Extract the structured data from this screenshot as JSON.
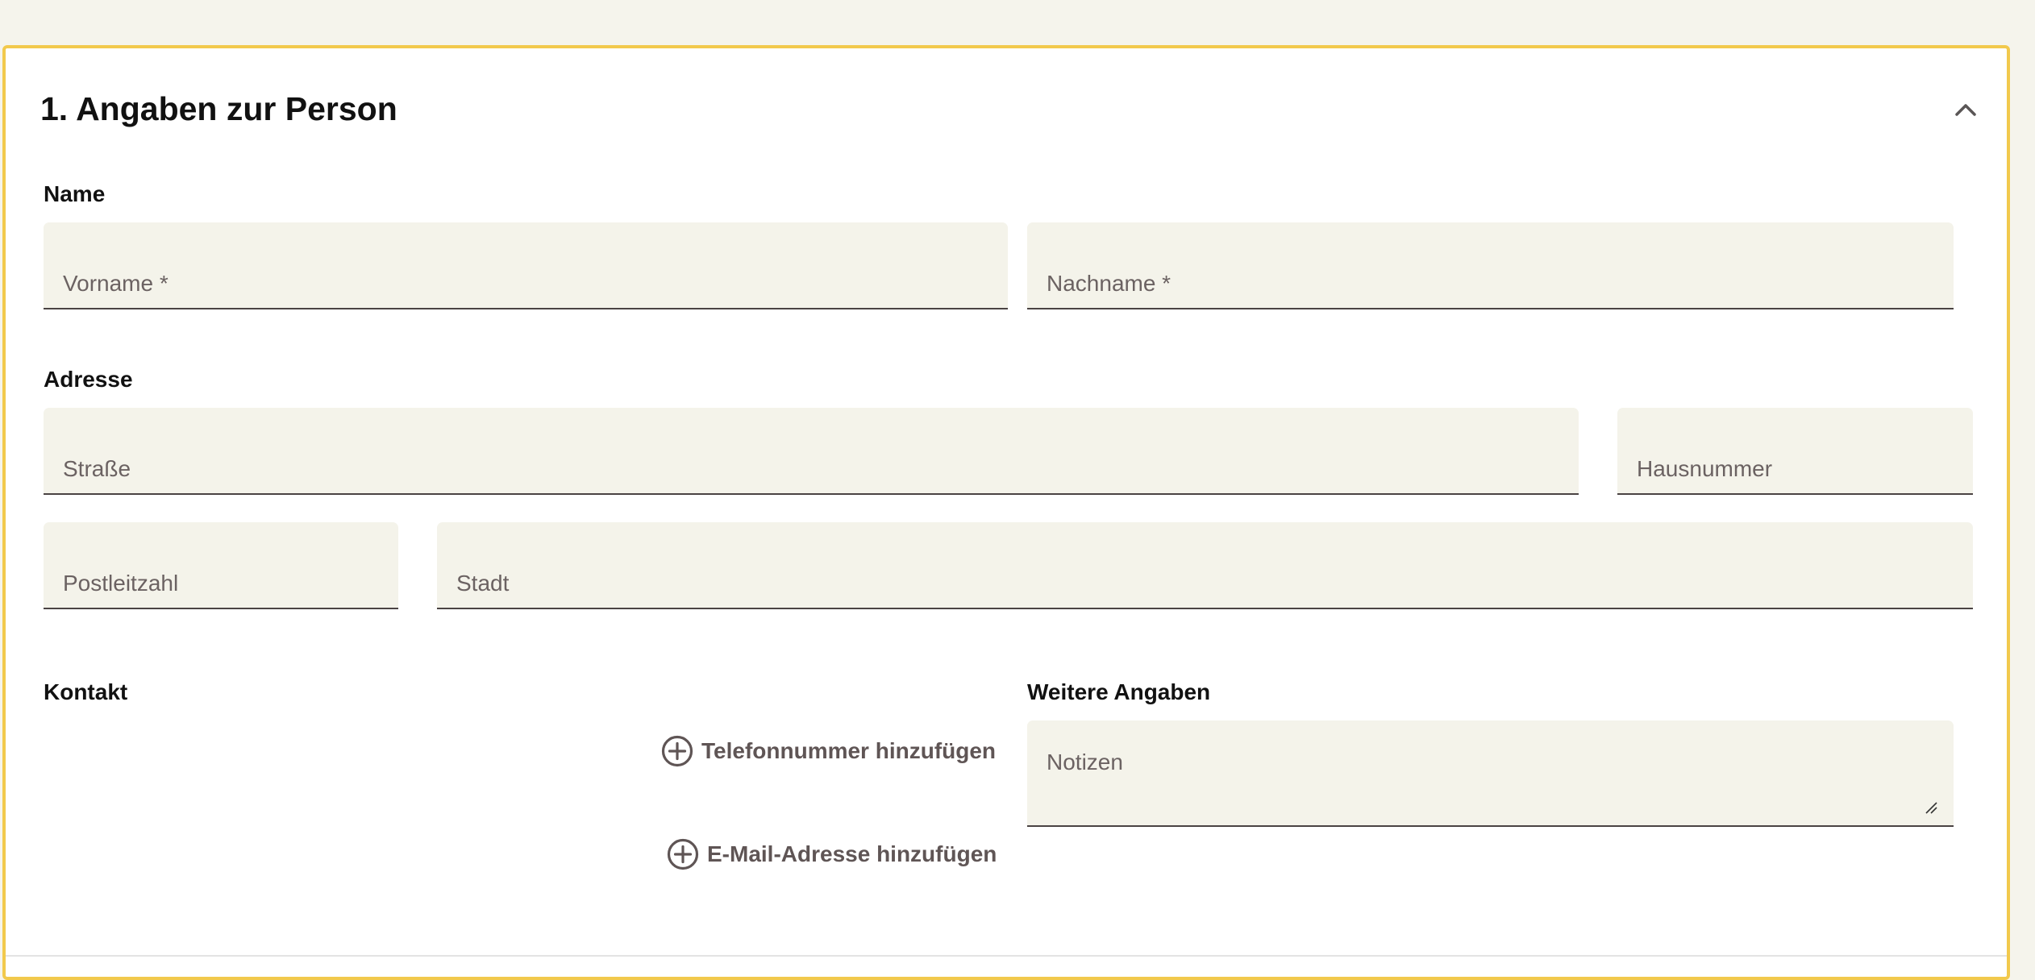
{
  "section": {
    "title": "1. Angaben zur Person",
    "collapse_icon": "chevron-up-icon"
  },
  "name_group": {
    "label": "Name",
    "vorname_placeholder": "Vorname *",
    "nachname_placeholder": "Nachname *"
  },
  "address_group": {
    "label": "Adresse",
    "street_placeholder": "Straße",
    "house_number_placeholder": "Hausnummer",
    "postal_code_placeholder": "Postleitzahl",
    "city_placeholder": "Stadt"
  },
  "contact_group": {
    "label": "Kontakt",
    "add_phone_label": "Telefonnummer hinzufügen",
    "add_email_label": "E-Mail-Adresse hinzufügen",
    "add_icon": "plus-circle-icon"
  },
  "more_info_group": {
    "label": "Weitere Angaben",
    "notes_placeholder": "Notizen"
  },
  "colors": {
    "card_border": "#f2c94c",
    "field_background": "#f4f3ea",
    "page_background": "#f5f4ec",
    "link_text": "#5f5555"
  }
}
